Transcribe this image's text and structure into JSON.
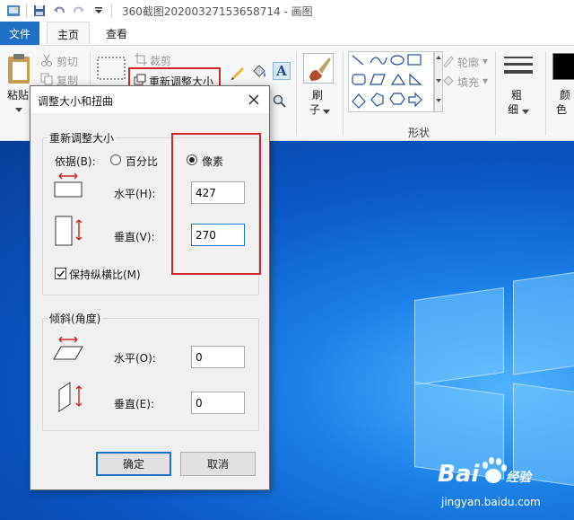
{
  "window": {
    "title": "360截图20200327153658714 - 画图"
  },
  "tabs": {
    "file": "文件",
    "home": "主页",
    "view": "查看"
  },
  "ribbon": {
    "paste": "粘贴",
    "cut": "剪切",
    "copy": "复制",
    "crop": "裁剪",
    "resize": "重新调整大小",
    "brush_1": "刷",
    "brush_2": "子",
    "outline": "轮廓",
    "fill": "填充",
    "shapes_group": "形状",
    "size_1": "粗",
    "size_2": "细",
    "color_1": "颜",
    "color_2": "色"
  },
  "dialog": {
    "title": "调整大小和扭曲",
    "resize_group": "重新调整大小",
    "by_label": "依据(B):",
    "percent": "百分比",
    "pixels": "像素",
    "horizontal_label": "水平(H):",
    "horizontal_value": "427",
    "vertical_label": "垂直(V):",
    "vertical_value": "270",
    "keep_ratio": "保持纵横比(M)",
    "skew_group": "倾斜(角度)",
    "skew_h_label": "水平(O):",
    "skew_h_value": "0",
    "skew_v_label": "垂直(E):",
    "skew_v_value": "0",
    "ok": "确定",
    "cancel": "取消"
  },
  "watermark": {
    "logo": "Bai 百度 经验",
    "url": "jingyan.baidu.com"
  },
  "colors": {
    "accent": "#1e6fc5",
    "highlight": "#d6262c",
    "desktop": "#0b58c6"
  }
}
